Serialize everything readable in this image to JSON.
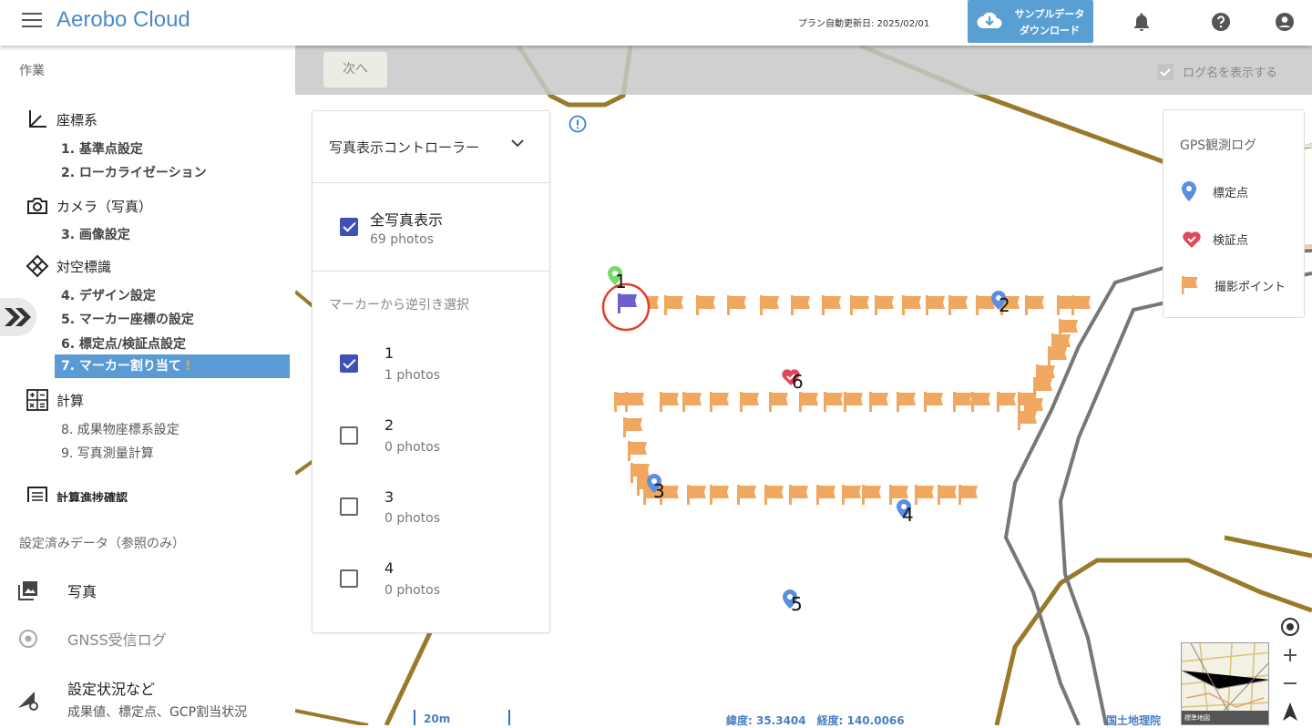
{
  "header": {
    "brand": "Aerobo Cloud",
    "plan_update": "プラン自動更新日: 2025/02/01",
    "download_line1": "サンプルデータ",
    "download_line2": "ダウンロード"
  },
  "sidebar": {
    "work_title": "作業",
    "groups": {
      "coord": "座標系",
      "camera": "カメラ（写真）",
      "target": "対空標識",
      "calc": "計算",
      "progress": "計算進捗確認"
    },
    "steps": {
      "s1": "1. 基準点設定",
      "s2": "2. ローカライゼーション",
      "s3": "3. 画像設定",
      "s4": "4. デザイン設定",
      "s5": "5. マーカー座標の設定",
      "s6": "6. 標定点/検証点設定",
      "s7": "7. マーカー割り当て",
      "s7_warn": "!",
      "s8": "8. 成果物座標系設定",
      "s9": "9. 写真測量計算"
    },
    "data_title": "設定済みデータ（参照のみ）",
    "data_items": {
      "photos": "写真",
      "gnss": "GNSS受信ログ",
      "status": "設定状況など",
      "status_sub": "成果値、標定点、GCP割当状況"
    }
  },
  "map": {
    "next_button": "次へ",
    "show_log_names": "ログ名を表示する",
    "show_log_names_checked": true,
    "scale": "20m",
    "coords": "緯度: 35.3404　経度: 140.0066",
    "attribution": "国土地理院",
    "minimap_label": "標準地図",
    "marker_labels": [
      "1",
      "2",
      "3",
      "4",
      "5",
      "6"
    ]
  },
  "controller": {
    "title": "写真表示コントローラー",
    "all_label": "全写真表示",
    "all_count": "69 photos",
    "all_checked": true,
    "reverse_title": "マーカーから逆引き選択",
    "rows": [
      {
        "label": "1",
        "count": "1 photos",
        "checked": true
      },
      {
        "label": "2",
        "count": "0 photos",
        "checked": false
      },
      {
        "label": "3",
        "count": "0 photos",
        "checked": false
      },
      {
        "label": "4",
        "count": "0 photos",
        "checked": false
      }
    ]
  },
  "legend": {
    "title": "GPS観測ログ",
    "items": [
      {
        "label": "標定点",
        "color": "#5b8ee0"
      },
      {
        "label": "検証点",
        "color": "#e0485a"
      },
      {
        "label": "撮影ポイント",
        "color": "#f0a860"
      }
    ]
  },
  "colors": {
    "accent": "#5b9bd5",
    "brand": "#4a8ac9",
    "flag": "#f0a860",
    "gcp": "#5b8ee0",
    "check": "#e0485a",
    "selected_flag": "#6c5fd0",
    "contour": "#9a7a2a"
  }
}
